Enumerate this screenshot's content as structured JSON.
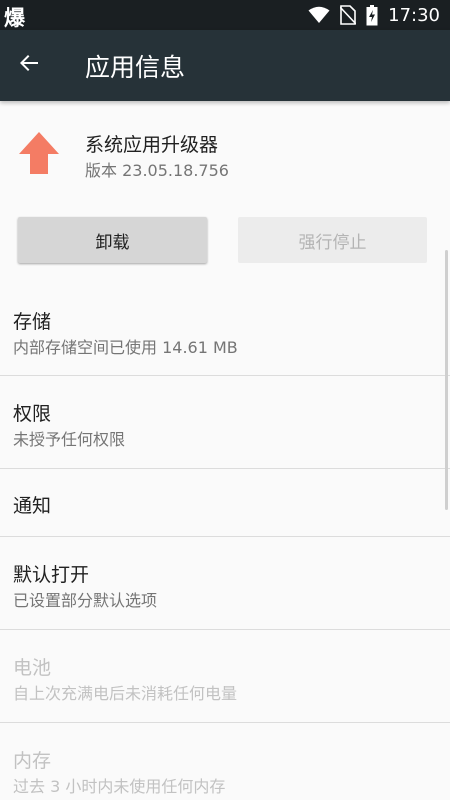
{
  "status_bar": {
    "left_glyph": "爆",
    "time": "17:30",
    "icons": [
      "wifi-icon",
      "no-sim-icon",
      "battery-charging-icon"
    ]
  },
  "app_bar": {
    "title": "应用信息",
    "back_icon": "arrow-left-icon"
  },
  "app": {
    "name": "系统应用升级器",
    "version": "版本 23.05.18.756",
    "icon": "up-arrow-icon",
    "icon_color": "#f47c64"
  },
  "buttons": {
    "uninstall": "卸载",
    "force_stop": "强行停止"
  },
  "items": [
    {
      "title": "存储",
      "subtitle": "内部存储空间已使用 14.61 MB",
      "enabled": true
    },
    {
      "title": "权限",
      "subtitle": "未授予任何权限",
      "enabled": true
    },
    {
      "title": "通知",
      "subtitle": "",
      "enabled": true
    },
    {
      "title": "默认打开",
      "subtitle": "已设置部分默认选项",
      "enabled": true
    },
    {
      "title": "电池",
      "subtitle": "自上次充满电后未消耗任何电量",
      "enabled": false
    },
    {
      "title": "内存",
      "subtitle": "过去 3 小时内未使用任何内存",
      "enabled": false
    }
  ]
}
